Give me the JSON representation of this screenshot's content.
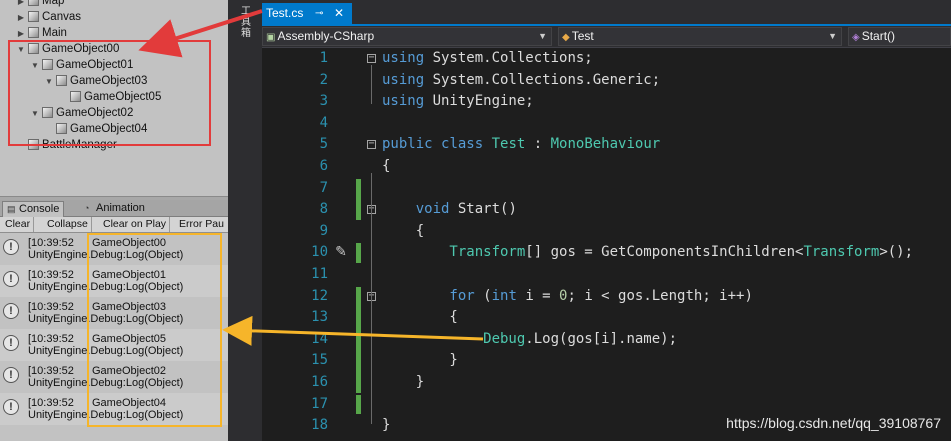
{
  "hierarchy": {
    "items": [
      {
        "label": "Map",
        "depth": 0,
        "expander": "▶"
      },
      {
        "label": "Canvas",
        "depth": 0,
        "expander": "▶"
      },
      {
        "label": "Main",
        "depth": 0,
        "expander": "▶"
      },
      {
        "label": "GameObject00",
        "depth": 0,
        "expander": "▼"
      },
      {
        "label": "GameObject01",
        "depth": 1,
        "expander": "▼"
      },
      {
        "label": "GameObject03",
        "depth": 2,
        "expander": "▼"
      },
      {
        "label": "GameObject05",
        "depth": 3,
        "expander": ""
      },
      {
        "label": "GameObject02",
        "depth": 1,
        "expander": "▼"
      },
      {
        "label": "GameObject04",
        "depth": 2,
        "expander": ""
      },
      {
        "label": "BattleManager",
        "depth": 0,
        "expander": ""
      }
    ]
  },
  "console": {
    "tabs": [
      {
        "label": "Console",
        "icon": "console-icon"
      },
      {
        "label": "Animation",
        "icon": "animation-icon"
      }
    ],
    "toolbar": [
      "Clear",
      "Collapse",
      "Clear on Play",
      "Error Pau"
    ],
    "entries": [
      {
        "time": "[10:39:52",
        "message": "GameObject00",
        "source": "UnityEngine.Debug:Log(Object)"
      },
      {
        "time": "[10:39:52",
        "message": "GameObject01",
        "source": "UnityEngine.Debug:Log(Object)"
      },
      {
        "time": "[10:39:52",
        "message": "GameObject03",
        "source": "UnityEngine.Debug:Log(Object)"
      },
      {
        "time": "[10:39:52",
        "message": "GameObject05",
        "source": "UnityEngine.Debug:Log(Object)"
      },
      {
        "time": "[10:39:52",
        "message": "GameObject02",
        "source": "UnityEngine.Debug:Log(Object)"
      },
      {
        "time": "[10:39:52",
        "message": "GameObject04",
        "source": "UnityEngine.Debug:Log(Object)"
      }
    ]
  },
  "vs": {
    "side_label": "工具箱",
    "tab": {
      "name": "Test.cs",
      "pin": "⊸",
      "close": "✕"
    },
    "nav": {
      "project": "Assembly-CSharp",
      "class": "Test",
      "member": "Start()"
    },
    "line_numbers": [
      "1",
      "2",
      "3",
      "4",
      "5",
      "6",
      "7",
      "8",
      "9",
      "10",
      "11",
      "12",
      "13",
      "14",
      "15",
      "16",
      "17",
      "18"
    ],
    "code_lines": [
      [
        {
          "t": "using ",
          "c": "k"
        },
        {
          "t": "System.Collections;",
          "c": "p"
        }
      ],
      [
        {
          "t": "using ",
          "c": "k"
        },
        {
          "t": "System.Collections.Generic;",
          "c": "p"
        }
      ],
      [
        {
          "t": "using ",
          "c": "k"
        },
        {
          "t": "UnityEngine;",
          "c": "p"
        }
      ],
      [],
      [
        {
          "t": "public ",
          "c": "k"
        },
        {
          "t": "class ",
          "c": "k"
        },
        {
          "t": "Test",
          "c": "t"
        },
        {
          "t": " : ",
          "c": "p"
        },
        {
          "t": "MonoBehaviour",
          "c": "t"
        }
      ],
      [
        {
          "t": "{",
          "c": "p"
        }
      ],
      [],
      [
        {
          "t": "    void ",
          "c": "k"
        },
        {
          "t": "Start",
          "c": "f"
        },
        {
          "t": "()",
          "c": "p"
        }
      ],
      [
        {
          "t": "    {",
          "c": "p"
        }
      ],
      [
        {
          "t": "        Transform",
          "c": "t"
        },
        {
          "t": "[] gos = GetComponentsInChildren<",
          "c": "p"
        },
        {
          "t": "Transform",
          "c": "t"
        },
        {
          "t": ">();",
          "c": "p"
        }
      ],
      [],
      [
        {
          "t": "        for ",
          "c": "k"
        },
        {
          "t": "(",
          "c": "p"
        },
        {
          "t": "int ",
          "c": "k"
        },
        {
          "t": "i = ",
          "c": "p"
        },
        {
          "t": "0",
          "c": "n"
        },
        {
          "t": "; i < gos.Length; i++)",
          "c": "p"
        }
      ],
      [
        {
          "t": "        {",
          "c": "p"
        }
      ],
      [
        {
          "t": "            Debug",
          "c": "t"
        },
        {
          "t": ".Log(gos[i].name);",
          "c": "p"
        }
      ],
      [
        {
          "t": "        }",
          "c": "p"
        }
      ],
      [
        {
          "t": "    }",
          "c": "p"
        }
      ],
      [],
      [
        {
          "t": "}",
          "c": "p"
        }
      ]
    ],
    "watermark": "https://blog.csdn.net/qq_39108767"
  },
  "colors": {
    "annotation_red": "#e23b3b",
    "annotation_orange": "#f6b52a",
    "vs_accent": "#007acc",
    "keyword": "#569cd6",
    "type": "#4ec9b0",
    "change_bar": "#57a64a"
  }
}
